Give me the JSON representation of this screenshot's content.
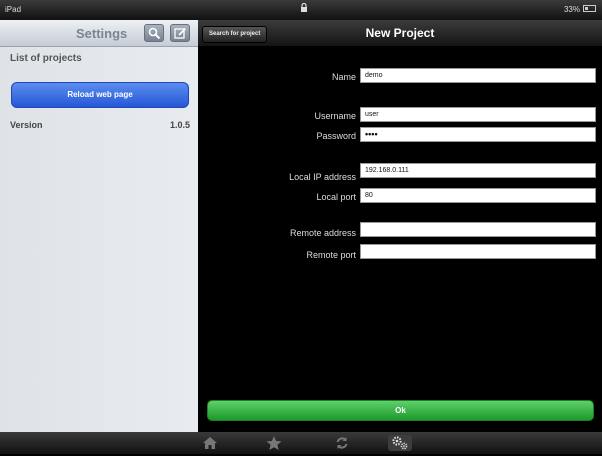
{
  "status_bar": {
    "device": "iPad",
    "battery": "33%"
  },
  "sidebar": {
    "title": "Settings",
    "list_header": "List of projects",
    "reload_button": "Reload web page",
    "version_label": "Version",
    "version_value": "1.0.5"
  },
  "main": {
    "search_button": "Search for project",
    "title": "New Project",
    "fields": {
      "name": {
        "label": "Name",
        "value": "demo"
      },
      "username": {
        "label": "Username",
        "value": "user"
      },
      "password": {
        "label": "Password",
        "value": "••••"
      },
      "local_ip": {
        "label": "Local IP address",
        "value": "192.168.0.111"
      },
      "local_port": {
        "label": "Local port",
        "value": "80"
      },
      "remote_address": {
        "label": "Remote address",
        "value": ""
      },
      "remote_port": {
        "label": "Remote port",
        "value": ""
      }
    },
    "ok_button": "Ok"
  },
  "tab_bar": {
    "tabs": [
      "home-icon",
      "star-icon",
      "refresh-icon",
      "gears-icon"
    ],
    "active": "gears-icon"
  }
}
